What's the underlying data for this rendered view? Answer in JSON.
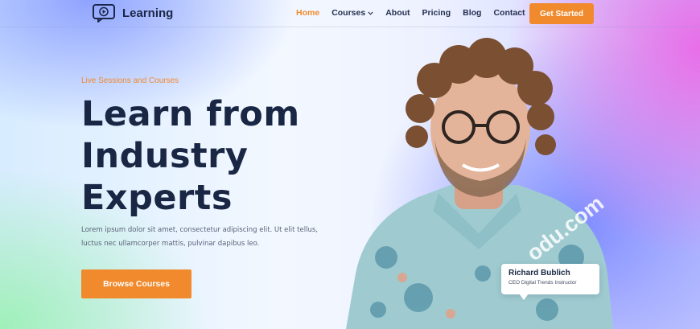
{
  "header": {
    "logo_text": "Learning",
    "nav": [
      {
        "label": "Home",
        "active": true
      },
      {
        "label": "Courses",
        "has_dropdown": true
      },
      {
        "label": "About"
      },
      {
        "label": "Pricing"
      },
      {
        "label": "Blog"
      },
      {
        "label": "Contact"
      }
    ],
    "cta_label": "Get Started"
  },
  "hero": {
    "eyebrow": "Live Sessions and Courses",
    "headline_lines": [
      "Learn from",
      "Industry",
      "Experts"
    ],
    "description_lines": [
      "Lorem ipsum dolor sit amet, consectetur adipiscing elit. Ut elit tellus,",
      "luctus nec ullamcorper mattis, pulvinar dapibus leo."
    ],
    "button_label": "Browse Courses"
  },
  "instructor_card": {
    "name": "Richard Bublich",
    "role": "CEO Digital Trends Instructor"
  },
  "watermark": "odu.com",
  "colors": {
    "accent": "#f08a2d",
    "heading": "#1a2744",
    "body_text": "#5a6378"
  },
  "icons": {
    "logo": "video-play-chat-icon",
    "dropdown": "chevron-down-icon"
  }
}
